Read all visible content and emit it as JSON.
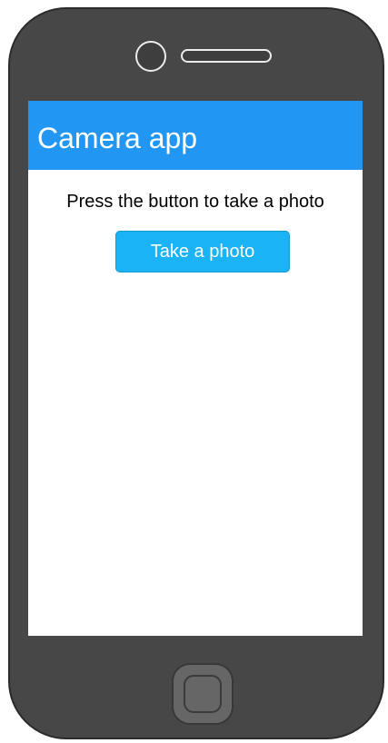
{
  "app": {
    "title": "Camera app",
    "instruction": "Press the button to take a photo",
    "take_photo_label": "Take a photo"
  },
  "device": {
    "frame_color": "#474747",
    "screen_color": "#ffffff"
  },
  "colors": {
    "header": "#2196f3",
    "button": "#1ab3f5"
  },
  "icons": [
    "front-camera-icon",
    "speaker-grille-icon",
    "home-button-icon"
  ]
}
